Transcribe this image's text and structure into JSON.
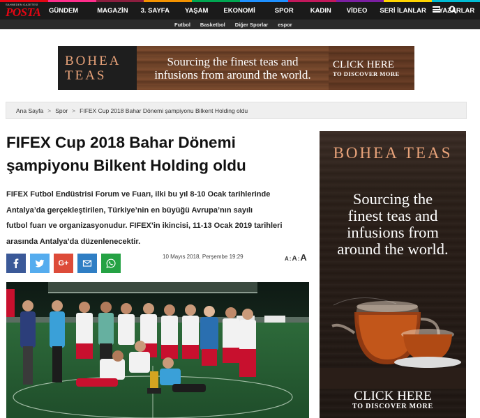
{
  "header": {
    "logo_small": "SAHNEDEN GAZETESİ",
    "logo_text": "POSTA",
    "nav_items": [
      {
        "label": "GÜNDEM",
        "color": "#e30613"
      },
      {
        "label": "MAGAZİN",
        "color": "#ff2d8b"
      },
      {
        "label": "3. SAYFA",
        "color": "#8b1e3f"
      },
      {
        "label": "YAŞAM",
        "color": "#f39200"
      },
      {
        "label": "EKONOMİ",
        "color": "#00a651"
      },
      {
        "label": "SPOR",
        "color": "#1e90ff"
      },
      {
        "label": "KADIN",
        "color": "#c2185b"
      },
      {
        "label": "VİDEO",
        "color": "#7b1fa2"
      },
      {
        "label": "SERİ İLANLAR",
        "color": "#ffd400"
      },
      {
        "label": "YAZARLAR",
        "color": "#00bcd4"
      }
    ],
    "menu_icon": "hamburger-icon",
    "search_icon": "search-icon"
  },
  "subnav": {
    "items": [
      "Futbol",
      "Basketbol",
      "Diğer Sporlar",
      "espor"
    ]
  },
  "ad_top": {
    "brand_line1": "BOHEA",
    "brand_line2": "TEAS",
    "tagline_line1": "Sourcing the finest teas and",
    "tagline_line2": "infusions from around the world.",
    "cta_main": "CLICK HERE",
    "cta_sub": "TO DISCOVER MORE"
  },
  "breadcrumb": {
    "home": "Ana Sayfa",
    "section": "Spor",
    "current": "FIFEX Cup 2018 Bahar Dönemi şampiyonu Bilkent Holding oldu",
    "separator": ">"
  },
  "article": {
    "title_line1": "FIFEX Cup 2018 Bahar Dönemi",
    "title_line2": "şampiyonu Bilkent Holding oldu",
    "summary_lines": [
      "FIFEX Futbol Endüstrisi Forum ve Fuarı, ilki bu yıl 8-10 Ocak tarihlerinde",
      "Antalya’da gerçekleştirilen, Türkiye’nin en büyüğü Avrupa’nın sayılı",
      "futbol fuarı ve organizasyonudur. FIFEX’in ikincisi, 11-13 Ocak 2019 tarihleri",
      "arasında Antalya’da düzenlenecektir."
    ],
    "date": "10 Mayıs 2018, Perşembe 19:29",
    "font_small": "A",
    "font_medium": "A",
    "font_large": "A",
    "font_sep": ":"
  },
  "share_buttons": [
    {
      "icon": "facebook-icon",
      "color": "#3b5998"
    },
    {
      "icon": "twitter-icon",
      "color": "#55acee"
    },
    {
      "icon": "google-plus-icon",
      "color": "#dd4b39",
      "label": "G+"
    },
    {
      "icon": "mail-icon",
      "color": "#2f7ec4"
    },
    {
      "icon": "whatsapp-icon",
      "color": "#25a244"
    }
  ],
  "ad_side": {
    "brand": "BOHEA TEAS",
    "text_lines": [
      "Sourcing the",
      "finest teas and",
      "infusions from",
      "around the world."
    ],
    "cta_main": "CLICK HERE",
    "cta_sub": "TO DISCOVER MORE"
  }
}
